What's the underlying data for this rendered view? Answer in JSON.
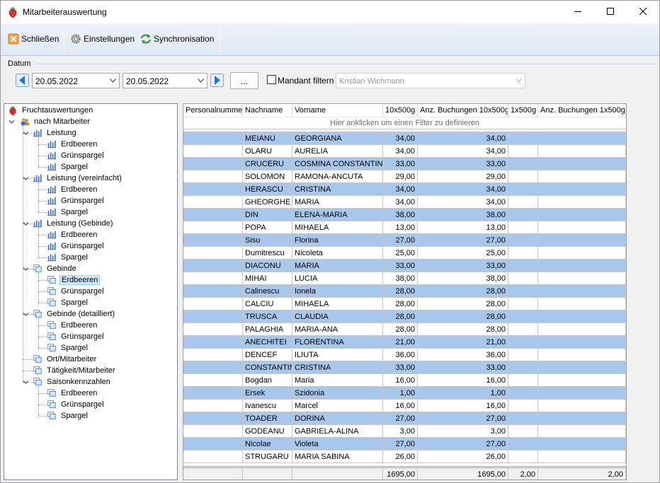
{
  "window": {
    "title": "Mitarbeiterauswertung"
  },
  "toolbar": {
    "close_label": "Schließen",
    "settings_label": "Einstellungen",
    "sync_label": "Synchronisation"
  },
  "datum": {
    "legend": "Datum",
    "from": "20.05.2022",
    "to": "20.05.2022",
    "dots_label": "...",
    "mandant_label": "Mandant filtern",
    "mandant_value": "Kristian Wichmann",
    "mandant_checked": false
  },
  "tree": {
    "root": "Fruchtauswertungen",
    "mitarbeiter": "nach Mitarbeiter",
    "groups": [
      {
        "label": "Leistung",
        "icon": "bar-chart-icon",
        "children": [
          "Erdbeeren",
          "Grünspargel",
          "Spargel"
        ]
      },
      {
        "label": "Leistung (vereinfacht)",
        "icon": "bar-chart-icon",
        "children": [
          "Erdbeeren",
          "Grünspargel",
          "Spargel"
        ]
      },
      {
        "label": "Leistung (Gebinde)",
        "icon": "bar-chart-icon",
        "children": [
          "Erdbeeren",
          "Grünspargel",
          "Spargel"
        ]
      },
      {
        "label": "Gebinde",
        "icon": "crate-icon",
        "children": [
          "Erdbeeren",
          "Grünspargel",
          "Spargel"
        ],
        "selected_child": 0
      },
      {
        "label": "Gebinde (detailliert)",
        "icon": "crate-icon",
        "children": [
          "Erdbeeren",
          "Grünspargel",
          "Spargel"
        ]
      },
      {
        "label": "Ort/Mitarbeiter",
        "icon": "crate-icon",
        "children": []
      },
      {
        "label": "Tätigkeit/Mitarbeiter",
        "icon": "crate-icon",
        "children": []
      },
      {
        "label": "Saisonkennzahlen",
        "icon": "crate-icon",
        "children": [
          "Erdbeeren",
          "Grünspargel",
          "Spargel"
        ]
      }
    ]
  },
  "grid": {
    "columns": [
      "Personalnummer",
      "Nachname",
      "Vorname",
      "10x500g",
      "Anz. Buchungen 10x500g",
      "1x500g",
      "Anz. Buchungen 1x500g"
    ],
    "filter_hint": "Hier anklicken um einen Filter zu definieren",
    "rows": [
      [
        "",
        "MEIANU",
        "GEORGIANA",
        "34,00",
        "34,00",
        "",
        ""
      ],
      [
        "",
        "OLARU",
        "AURELIA",
        "34,00",
        "34,00",
        "",
        ""
      ],
      [
        "",
        "CRUCERU",
        "COSMINA CONSTANTINA",
        "33,00",
        "33,00",
        "",
        ""
      ],
      [
        "",
        "SOLOMON",
        "RAMONA-ANCUTA",
        "29,00",
        "29,00",
        "",
        ""
      ],
      [
        "",
        "HERASCU",
        "CRISTINA",
        "34,00",
        "34,00",
        "",
        ""
      ],
      [
        "",
        "GHEORGHE",
        "MARIA",
        "34,00",
        "34,00",
        "",
        ""
      ],
      [
        "",
        "DIN",
        "ELENA-MARIA",
        "38,00",
        "38,00",
        "",
        ""
      ],
      [
        "",
        "POPA",
        "MIHAELA",
        "13,00",
        "13,00",
        "",
        ""
      ],
      [
        "",
        "Sisu",
        "Florina",
        "27,00",
        "27,00",
        "",
        ""
      ],
      [
        "",
        "Dumitrescu",
        "Nicoleta",
        "25,00",
        "25,00",
        "",
        ""
      ],
      [
        "",
        "DIACONU",
        "MARIA",
        "33,00",
        "33,00",
        "",
        ""
      ],
      [
        "",
        "MIHAI",
        "LUCIA",
        "38,00",
        "38,00",
        "",
        ""
      ],
      [
        "",
        "Calinescu",
        "Ionela",
        "28,00",
        "28,00",
        "",
        ""
      ],
      [
        "",
        "CALCIU",
        "MIHAELA",
        "28,00",
        "28,00",
        "",
        ""
      ],
      [
        "",
        "TRUSCA",
        "CLAUDIA",
        "28,00",
        "28,00",
        "",
        ""
      ],
      [
        "",
        "PALAGHIA",
        "MARIA-ANA",
        "28,00",
        "28,00",
        "",
        ""
      ],
      [
        "",
        "ANECHITEI",
        "FLORENTINA",
        "21,00",
        "21,00",
        "",
        ""
      ],
      [
        "",
        "DENCEF",
        "ILIUTA",
        "36,00",
        "36,00",
        "",
        ""
      ],
      [
        "",
        "CONSTANTIN",
        "CRISTINA",
        "33,00",
        "33,00",
        "",
        ""
      ],
      [
        "",
        "Bogdan",
        "Maria",
        "16,00",
        "16,00",
        "",
        ""
      ],
      [
        "",
        "Ersek",
        "Szidonia",
        "1,00",
        "1,00",
        "",
        ""
      ],
      [
        "",
        "Ivanescu",
        "Marcel",
        "16,00",
        "16,00",
        "",
        ""
      ],
      [
        "",
        "TOADER",
        "DORINA",
        "27,00",
        "27,00",
        "",
        ""
      ],
      [
        "",
        "GODEANU",
        "GABRIELA-ALINA",
        "3,00",
        "3,00",
        "",
        ""
      ],
      [
        "",
        "Nicolae",
        "Violeta",
        "27,00",
        "27,00",
        "",
        ""
      ],
      [
        "",
        "STRUGARU",
        "MARIA SABINA",
        "26,00",
        "26,00",
        "",
        ""
      ]
    ],
    "totals": [
      "",
      "",
      "",
      "1695,00",
      "1695,00",
      "2,00",
      "2,00"
    ]
  },
  "colors": {
    "alt_row": "#a7c8ec",
    "accent": "#1e78d7",
    "selected_tree": "#cce8ff"
  }
}
